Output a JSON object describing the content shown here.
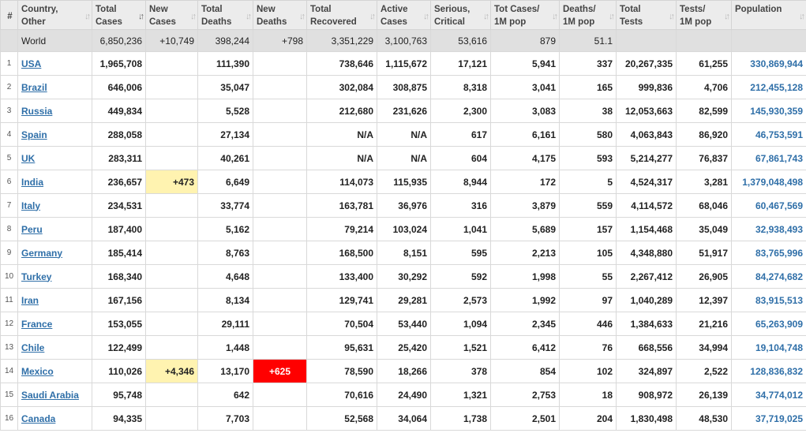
{
  "columns": [
    {
      "key": "rank",
      "l1": "#",
      "l2": "",
      "sort": false
    },
    {
      "key": "country",
      "l1": "Country,",
      "l2": "Other",
      "sort": true
    },
    {
      "key": "total_cases",
      "l1": "Total",
      "l2": "Cases",
      "sort": true,
      "active": true
    },
    {
      "key": "new_cases",
      "l1": "New",
      "l2": "Cases",
      "sort": true
    },
    {
      "key": "total_deaths",
      "l1": "Total",
      "l2": "Deaths",
      "sort": true
    },
    {
      "key": "new_deaths",
      "l1": "New",
      "l2": "Deaths",
      "sort": true
    },
    {
      "key": "total_recovered",
      "l1": "Total",
      "l2": "Recovered",
      "sort": true
    },
    {
      "key": "active_cases",
      "l1": "Active",
      "l2": "Cases",
      "sort": true
    },
    {
      "key": "serious",
      "l1": "Serious,",
      "l2": "Critical",
      "sort": true
    },
    {
      "key": "cases_1m",
      "l1": "Tot Cases/",
      "l2": "1M pop",
      "sort": true
    },
    {
      "key": "deaths_1m",
      "l1": "Deaths/",
      "l2": "1M pop",
      "sort": true
    },
    {
      "key": "total_tests",
      "l1": "Total",
      "l2": "Tests",
      "sort": true
    },
    {
      "key": "tests_1m",
      "l1": "Tests/",
      "l2": "1M pop",
      "sort": true
    },
    {
      "key": "population",
      "l1": "Population",
      "l2": "",
      "sort": true
    }
  ],
  "sort_icon": "sort-arrows-icon",
  "world": {
    "rank": "",
    "country": "World",
    "total_cases": "6,850,236",
    "new_cases": "+10,749",
    "total_deaths": "398,244",
    "new_deaths": "+798",
    "total_recovered": "3,351,229",
    "active_cases": "3,100,763",
    "serious": "53,616",
    "cases_1m": "879",
    "deaths_1m": "51.1",
    "total_tests": "",
    "tests_1m": "",
    "population": ""
  },
  "rows": [
    {
      "rank": "1",
      "country": "USA",
      "total_cases": "1,965,708",
      "new_cases": "",
      "total_deaths": "111,390",
      "new_deaths": "",
      "total_recovered": "738,646",
      "active_cases": "1,115,672",
      "serious": "17,121",
      "cases_1m": "5,941",
      "deaths_1m": "337",
      "total_tests": "20,267,335",
      "tests_1m": "61,255",
      "population": "330,869,944"
    },
    {
      "rank": "2",
      "country": "Brazil",
      "total_cases": "646,006",
      "new_cases": "",
      "total_deaths": "35,047",
      "new_deaths": "",
      "total_recovered": "302,084",
      "active_cases": "308,875",
      "serious": "8,318",
      "cases_1m": "3,041",
      "deaths_1m": "165",
      "total_tests": "999,836",
      "tests_1m": "4,706",
      "population": "212,455,128"
    },
    {
      "rank": "3",
      "country": "Russia",
      "total_cases": "449,834",
      "new_cases": "",
      "total_deaths": "5,528",
      "new_deaths": "",
      "total_recovered": "212,680",
      "active_cases": "231,626",
      "serious": "2,300",
      "cases_1m": "3,083",
      "deaths_1m": "38",
      "total_tests": "12,053,663",
      "tests_1m": "82,599",
      "population": "145,930,359"
    },
    {
      "rank": "4",
      "country": "Spain",
      "total_cases": "288,058",
      "new_cases": "",
      "total_deaths": "27,134",
      "new_deaths": "",
      "total_recovered": "N/A",
      "active_cases": "N/A",
      "serious": "617",
      "cases_1m": "6,161",
      "deaths_1m": "580",
      "total_tests": "4,063,843",
      "tests_1m": "86,920",
      "population": "46,753,591"
    },
    {
      "rank": "5",
      "country": "UK",
      "total_cases": "283,311",
      "new_cases": "",
      "total_deaths": "40,261",
      "new_deaths": "",
      "total_recovered": "N/A",
      "active_cases": "N/A",
      "serious": "604",
      "cases_1m": "4,175",
      "deaths_1m": "593",
      "total_tests": "5,214,277",
      "tests_1m": "76,837",
      "population": "67,861,743"
    },
    {
      "rank": "6",
      "country": "India",
      "total_cases": "236,657",
      "new_cases": "+473",
      "total_deaths": "6,649",
      "new_deaths": "",
      "total_recovered": "114,073",
      "active_cases": "115,935",
      "serious": "8,944",
      "cases_1m": "172",
      "deaths_1m": "5",
      "total_tests": "4,524,317",
      "tests_1m": "3,281",
      "population": "1,379,048,498"
    },
    {
      "rank": "7",
      "country": "Italy",
      "total_cases": "234,531",
      "new_cases": "",
      "total_deaths": "33,774",
      "new_deaths": "",
      "total_recovered": "163,781",
      "active_cases": "36,976",
      "serious": "316",
      "cases_1m": "3,879",
      "deaths_1m": "559",
      "total_tests": "4,114,572",
      "tests_1m": "68,046",
      "population": "60,467,569"
    },
    {
      "rank": "8",
      "country": "Peru",
      "total_cases": "187,400",
      "new_cases": "",
      "total_deaths": "5,162",
      "new_deaths": "",
      "total_recovered": "79,214",
      "active_cases": "103,024",
      "serious": "1,041",
      "cases_1m": "5,689",
      "deaths_1m": "157",
      "total_tests": "1,154,468",
      "tests_1m": "35,049",
      "population": "32,938,493"
    },
    {
      "rank": "9",
      "country": "Germany",
      "total_cases": "185,414",
      "new_cases": "",
      "total_deaths": "8,763",
      "new_deaths": "",
      "total_recovered": "168,500",
      "active_cases": "8,151",
      "serious": "595",
      "cases_1m": "2,213",
      "deaths_1m": "105",
      "total_tests": "4,348,880",
      "tests_1m": "51,917",
      "population": "83,765,996"
    },
    {
      "rank": "10",
      "country": "Turkey",
      "total_cases": "168,340",
      "new_cases": "",
      "total_deaths": "4,648",
      "new_deaths": "",
      "total_recovered": "133,400",
      "active_cases": "30,292",
      "serious": "592",
      "cases_1m": "1,998",
      "deaths_1m": "55",
      "total_tests": "2,267,412",
      "tests_1m": "26,905",
      "population": "84,274,682"
    },
    {
      "rank": "11",
      "country": "Iran",
      "total_cases": "167,156",
      "new_cases": "",
      "total_deaths": "8,134",
      "new_deaths": "",
      "total_recovered": "129,741",
      "active_cases": "29,281",
      "serious": "2,573",
      "cases_1m": "1,992",
      "deaths_1m": "97",
      "total_tests": "1,040,289",
      "tests_1m": "12,397",
      "population": "83,915,513"
    },
    {
      "rank": "12",
      "country": "France",
      "total_cases": "153,055",
      "new_cases": "",
      "total_deaths": "29,111",
      "new_deaths": "",
      "total_recovered": "70,504",
      "active_cases": "53,440",
      "serious": "1,094",
      "cases_1m": "2,345",
      "deaths_1m": "446",
      "total_tests": "1,384,633",
      "tests_1m": "21,216",
      "population": "65,263,909"
    },
    {
      "rank": "13",
      "country": "Chile",
      "total_cases": "122,499",
      "new_cases": "",
      "total_deaths": "1,448",
      "new_deaths": "",
      "total_recovered": "95,631",
      "active_cases": "25,420",
      "serious": "1,521",
      "cases_1m": "6,412",
      "deaths_1m": "76",
      "total_tests": "668,556",
      "tests_1m": "34,994",
      "population": "19,104,748"
    },
    {
      "rank": "14",
      "country": "Mexico",
      "total_cases": "110,026",
      "new_cases": "+4,346",
      "total_deaths": "13,170",
      "new_deaths": "+625",
      "total_recovered": "78,590",
      "active_cases": "18,266",
      "serious": "378",
      "cases_1m": "854",
      "deaths_1m": "102",
      "total_tests": "324,897",
      "tests_1m": "2,522",
      "population": "128,836,832"
    },
    {
      "rank": "15",
      "country": "Saudi Arabia",
      "total_cases": "95,748",
      "new_cases": "",
      "total_deaths": "642",
      "new_deaths": "",
      "total_recovered": "70,616",
      "active_cases": "24,490",
      "serious": "1,321",
      "cases_1m": "2,753",
      "deaths_1m": "18",
      "total_tests": "908,972",
      "tests_1m": "26,139",
      "population": "34,774,012"
    },
    {
      "rank": "16",
      "country": "Canada",
      "total_cases": "94,335",
      "new_cases": "",
      "total_deaths": "7,703",
      "new_deaths": "",
      "total_recovered": "52,568",
      "active_cases": "34,064",
      "serious": "1,738",
      "cases_1m": "2,501",
      "deaths_1m": "204",
      "total_tests": "1,830,498",
      "tests_1m": "48,530",
      "population": "37,719,025"
    }
  ],
  "colors": {
    "new_cases_highlight": "#fff3b0",
    "new_deaths_highlight": "#ff0000",
    "link": "#2f6fa8",
    "header_bg": "#ececec",
    "world_bg": "#e0e0e0"
  }
}
